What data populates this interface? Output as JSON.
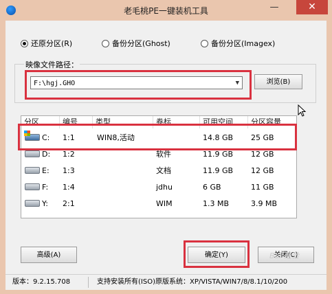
{
  "window": {
    "title": "老毛桃PE一键装机工具",
    "minimize": "—",
    "close": "✕"
  },
  "modes": [
    {
      "label": "还原分区(R)",
      "selected": true
    },
    {
      "label": "备份分区(Ghost)",
      "selected": false
    },
    {
      "label": "备份分区(Imagex)",
      "selected": false
    }
  ],
  "image_path": {
    "label": "映像文件路径：",
    "value": "F:\\hgj.GHO",
    "browse_label": "浏览(B)"
  },
  "table": {
    "columns": [
      "分区",
      "编号",
      "类型",
      "卷标",
      "可用空间",
      "分区容量"
    ],
    "rows": [
      {
        "drive": "C:",
        "num": "1:1",
        "type": "WIN8,活动",
        "label": "",
        "free": "14.8 GB",
        "size": "25 GB",
        "system": true
      },
      {
        "drive": "D:",
        "num": "1:2",
        "type": "",
        "label": "软件",
        "free": "11.9 GB",
        "size": "12 GB",
        "system": false
      },
      {
        "drive": "E:",
        "num": "1:3",
        "type": "",
        "label": "文档",
        "free": "11.9 GB",
        "size": "12 GB",
        "system": false
      },
      {
        "drive": "F:",
        "num": "1:4",
        "type": "",
        "label": "jdhu",
        "free": "6 GB",
        "size": "11 GB",
        "system": false
      },
      {
        "drive": "Y:",
        "num": "2:1",
        "type": "",
        "label": "WIM",
        "free": "1.3 MB",
        "size": "3.9 MB",
        "system": false
      }
    ]
  },
  "buttons": {
    "advanced": "高级(A)",
    "confirm": "确定(Y)",
    "close": "关闭(C)"
  },
  "status": {
    "version": "版本：9.2.15.708",
    "systems": "支持安装所有(ISO)原版系统：XP/VISTA/WIN7/8/8.1/10/200"
  },
  "watermark": "Bai 经验"
}
